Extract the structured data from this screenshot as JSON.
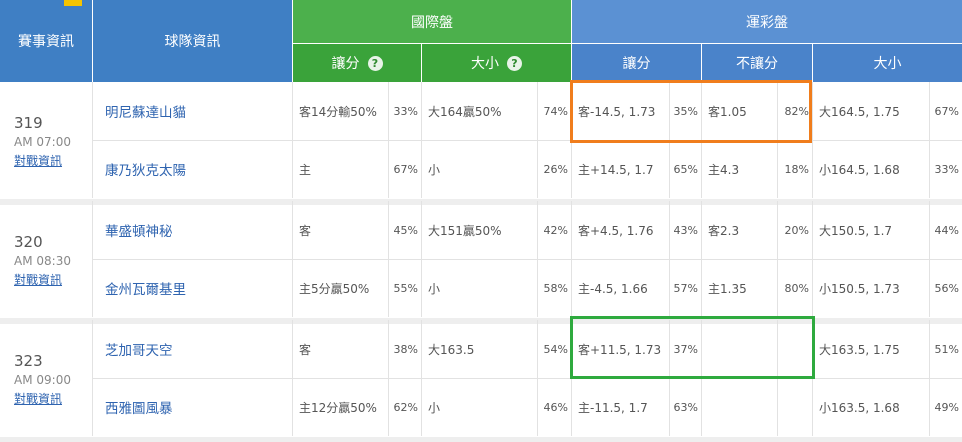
{
  "headers": {
    "event_info": "賽事資訊",
    "team_info": "球隊資訊",
    "intl": "國際盤",
    "yuncai": "運彩盤",
    "handicap": "讓分",
    "total": "大小",
    "no_handicap": "不讓分",
    "help_glyph": "?"
  },
  "colors": {
    "highlight_orange": "#f07d1c",
    "highlight_green": "#2eaa3e",
    "team_link": "#2f64b0"
  },
  "games": [
    {
      "no": "319",
      "time": "AM 07:00",
      "link": "對戰資訊",
      "rows": [
        {
          "team": "明尼蘇達山貓",
          "intl_spread": "客14分輸50%",
          "intl_spread_pct": "33%",
          "intl_total": "大164贏50%",
          "intl_total_pct": "74%",
          "yc_spread": "客-14.5, 1.73",
          "yc_spread_pct": "35%",
          "yc_ml": "客1.05",
          "yc_ml_pct": "82%",
          "yc_total": "大164.5, 1.75",
          "yc_total_pct": "67%"
        },
        {
          "team": "康乃狄克太陽",
          "intl_spread": "主",
          "intl_spread_pct": "67%",
          "intl_total": "小",
          "intl_total_pct": "26%",
          "yc_spread": "主+14.5, 1.7",
          "yc_spread_pct": "65%",
          "yc_ml": "主4.3",
          "yc_ml_pct": "18%",
          "yc_total": "小164.5, 1.68",
          "yc_total_pct": "33%"
        }
      ]
    },
    {
      "no": "320",
      "time": "AM 08:30",
      "link": "對戰資訊",
      "rows": [
        {
          "team": "華盛頓神秘",
          "intl_spread": "客",
          "intl_spread_pct": "45%",
          "intl_total": "大151贏50%",
          "intl_total_pct": "42%",
          "yc_spread": "客+4.5, 1.76",
          "yc_spread_pct": "43%",
          "yc_ml": "客2.3",
          "yc_ml_pct": "20%",
          "yc_total": "大150.5, 1.7",
          "yc_total_pct": "44%"
        },
        {
          "team": "金州瓦爾基里",
          "intl_spread": "主5分贏50%",
          "intl_spread_pct": "55%",
          "intl_total": "小",
          "intl_total_pct": "58%",
          "yc_spread": "主-4.5, 1.66",
          "yc_spread_pct": "57%",
          "yc_ml": "主1.35",
          "yc_ml_pct": "80%",
          "yc_total": "小150.5, 1.73",
          "yc_total_pct": "56%"
        }
      ]
    },
    {
      "no": "323",
      "time": "AM 09:00",
      "link": "對戰資訊",
      "rows": [
        {
          "team": "芝加哥天空",
          "intl_spread": "客",
          "intl_spread_pct": "38%",
          "intl_total": "大163.5",
          "intl_total_pct": "54%",
          "yc_spread": "客+11.5, 1.73",
          "yc_spread_pct": "37%",
          "yc_ml": "",
          "yc_ml_pct": "",
          "yc_total": "大163.5, 1.75",
          "yc_total_pct": "51%"
        },
        {
          "team": "西雅圖風暴",
          "intl_spread": "主12分贏50%",
          "intl_spread_pct": "62%",
          "intl_total": "小",
          "intl_total_pct": "46%",
          "yc_spread": "主-11.5, 1.7",
          "yc_spread_pct": "63%",
          "yc_ml": "",
          "yc_ml_pct": "",
          "yc_total": "小163.5, 1.68",
          "yc_total_pct": "49%"
        }
      ]
    }
  ]
}
